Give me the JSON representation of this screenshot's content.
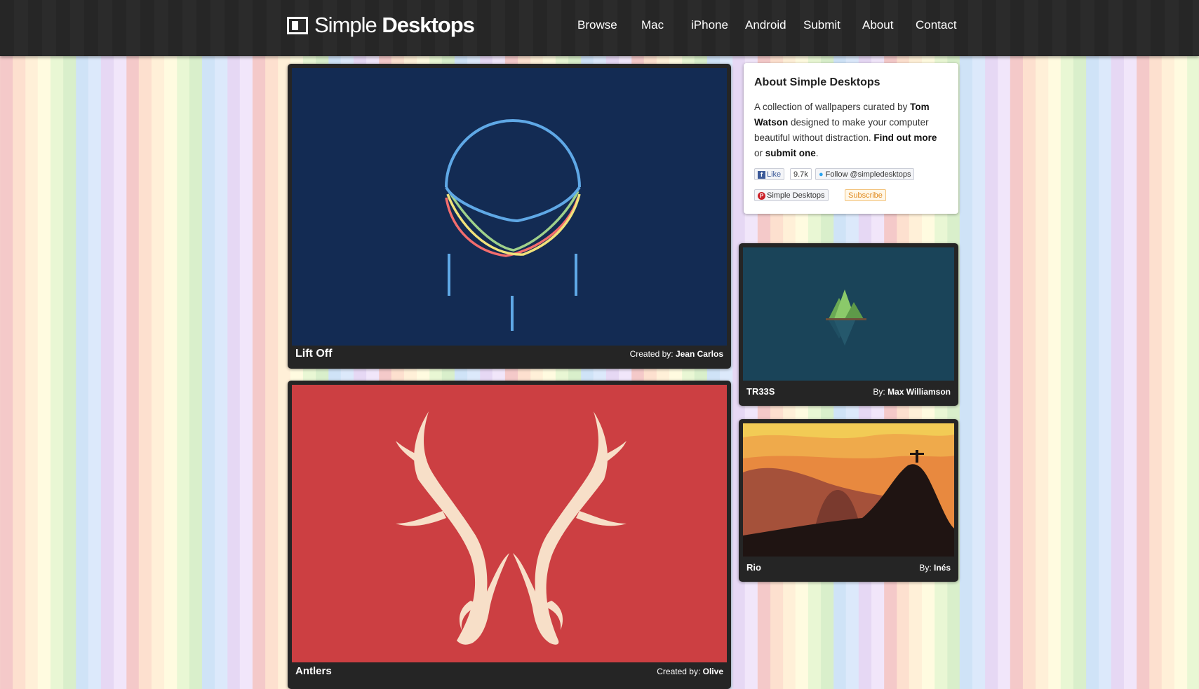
{
  "logo": {
    "light": "Simple ",
    "bold": "Desktops"
  },
  "nav": [
    "Browse",
    "Mac",
    "iPhone",
    "Android",
    "Submit",
    "About",
    "Contact"
  ],
  "about": {
    "title": "About Simple Desktops",
    "desc_1": "A collection of wallpapers curated by ",
    "author": "Tom Watson",
    "desc_2": " designed to make your computer beautiful without distraction. ",
    "find_more": "Find out more",
    "or": " or ",
    "submit_one": "submit one",
    "end": ".",
    "fb_like": "Like",
    "fb_count": "9.7k",
    "twitter_follow": "Follow @simpledesktops",
    "pinterest": "Simple Desktops",
    "subscribe": "Subscribe"
  },
  "desktops": [
    {
      "title": "Lift Off",
      "credit_prefix": "Created by: ",
      "author": "Jean Carlos",
      "bg": "#132b53"
    },
    {
      "title": "Antlers",
      "credit_prefix": "Created by: ",
      "author": "Olive",
      "bg": "#cc3f42"
    },
    {
      "title": "TR33S",
      "credit_prefix": "By: ",
      "author": "Max Williamson",
      "bg": "#1a4459"
    },
    {
      "title": "Rio",
      "credit_prefix": "By: ",
      "author": "Inés",
      "bg": "#e98a3e"
    }
  ]
}
